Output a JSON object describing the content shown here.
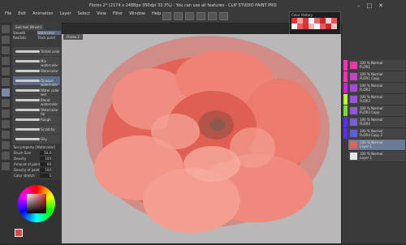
{
  "window": {
    "title": "Flores 2* (2174 x 2488px 350dpi 33.3%) - You can use all features - CLIP STUDIO PAINT PRO"
  },
  "menu": [
    "File",
    "Edit",
    "Animation",
    "Layer",
    "Select",
    "View",
    "Filter",
    "Window",
    "Help"
  ],
  "color_history": {
    "title": "Color History"
  },
  "subtool": {
    "tab": "Sub tool [Brush]",
    "groups": [
      "Smooth",
      "Watercolor",
      "Realistic",
      "Thick paint",
      "Ink",
      "Pencil",
      "Blur",
      "Feel"
    ],
    "brushes": [
      "Tinted color",
      "Mix watercolor",
      "Watercolor",
      "Opaque watercolor",
      "Water color wet",
      "Blend watercolor",
      "Watercolor tip",
      "Rough",
      "Scratchy",
      "Oily"
    ]
  },
  "tool_property": {
    "tab": "Tool property [Watercolor]",
    "rows": [
      {
        "label": "Brush Size",
        "value": "50.0"
      },
      {
        "label": "Density",
        "value": "100"
      },
      {
        "label": "Amount of paint",
        "value": "60"
      },
      {
        "label": "Density of paint",
        "value": "100"
      },
      {
        "label": "Color stretch",
        "value": "5"
      }
    ]
  },
  "color": {
    "main": "#d94b45"
  },
  "canvas": {
    "tab": "Flores 2"
  },
  "layers": [
    {
      "name": "100 % Normal",
      "sub": "FLOR1",
      "chip": "#e23aa7",
      "strip": "#ff2fbf"
    },
    {
      "name": "100 % Normal",
      "sub": "FLOR1 Copy",
      "chip": "#c83fd0",
      "strip": "#ff2fbf"
    },
    {
      "name": "100 % Normal",
      "sub": "FLOR2",
      "chip": "#a64bd8",
      "strip": "#d11fd1"
    },
    {
      "name": "100 % Normal",
      "sub": "FLOR3",
      "chip": "#9a54d6",
      "strip": "#b6ff3b"
    },
    {
      "name": "100 % Normal",
      "sub": "FLOR3 Copy",
      "chip": "#8c5bd5",
      "strip": "#7ed83b"
    },
    {
      "name": "100 % Normal",
      "sub": "FLOR4",
      "chip": "#7460d2",
      "strip": "#5a2cff"
    },
    {
      "name": "100 % Normal",
      "sub": "FLOR4 Copy 2",
      "chip": "#5f60cf",
      "strip": "#5a2cff"
    },
    {
      "name": "100 % Normal",
      "sub": "Layer 1",
      "chip": "#e2635b",
      "strip": "#3a3a3a"
    },
    {
      "name": "100 % Normal",
      "sub": "Layer 1",
      "chip": "#e6e6e6",
      "strip": "#3a3a3a"
    }
  ]
}
